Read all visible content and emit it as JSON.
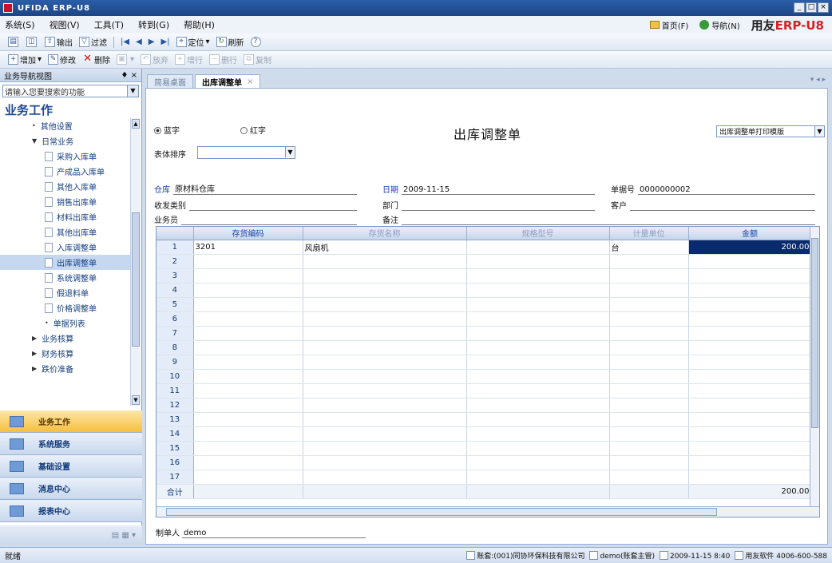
{
  "window": {
    "title": "UFIDA ERP-U8"
  },
  "menu": [
    "系统(S)",
    "视图(V)",
    "工具(T)",
    "转到(G)",
    "帮助(H)"
  ],
  "brand": {
    "home": "首页(F)",
    "nav": "导航(N)",
    "logo_a": "用友",
    "logo_b": "ERP-U8"
  },
  "toolbar1": [
    {
      "icon": "print-icon",
      "label": ""
    },
    {
      "icon": "preview-icon",
      "label": ""
    },
    {
      "icon": "export-icon",
      "label": "输出"
    },
    {
      "icon": "filter-icon",
      "label": "过滤"
    },
    {
      "icon": "first-icon",
      "label": "|◀"
    },
    {
      "icon": "prev-icon",
      "label": "◀"
    },
    {
      "icon": "next-icon",
      "label": "▶"
    },
    {
      "icon": "last-icon",
      "label": "▶|"
    },
    {
      "icon": "locate-icon",
      "label": "定位"
    },
    {
      "icon": "refresh-icon",
      "label": "刷新"
    },
    {
      "icon": "help-icon",
      "label": ""
    }
  ],
  "toolbar2": [
    {
      "icon": "add-icon",
      "label": "增加",
      "disabled": false
    },
    {
      "icon": "edit-icon",
      "label": "修改",
      "disabled": false
    },
    {
      "icon": "delete-icon",
      "label": "删除",
      "disabled": false
    },
    {
      "icon": "save-icon",
      "label": "",
      "disabled": true
    },
    {
      "icon": "discard-icon",
      "label": "放弃",
      "disabled": true
    },
    {
      "icon": "insert-row-icon",
      "label": "增行",
      "disabled": true
    },
    {
      "icon": "delete-row-icon",
      "label": "删行",
      "disabled": true
    },
    {
      "icon": "copy-icon",
      "label": "复制",
      "disabled": true
    }
  ],
  "sidebar": {
    "header": "业务导航视图",
    "pin": "♦ ×",
    "search_placeholder": "请输入您要搜索的功能",
    "section_title": "业务工作",
    "tree": [
      {
        "level": 1,
        "type": "leaf",
        "label": "其他设置"
      },
      {
        "level": 1,
        "type": "open",
        "label": "日常业务"
      },
      {
        "level": 2,
        "type": "doc",
        "label": "采购入库单"
      },
      {
        "level": 2,
        "type": "doc",
        "label": "产成品入库单"
      },
      {
        "level": 2,
        "type": "doc",
        "label": "其他入库单"
      },
      {
        "level": 2,
        "type": "doc",
        "label": "销售出库单"
      },
      {
        "level": 2,
        "type": "doc",
        "label": "材料出库单"
      },
      {
        "level": 2,
        "type": "doc",
        "label": "其他出库单"
      },
      {
        "level": 2,
        "type": "doc",
        "label": "入库调整单"
      },
      {
        "level": 2,
        "type": "doc",
        "label": "出库调整单",
        "selected": true
      },
      {
        "level": 2,
        "type": "doc",
        "label": "系统调整单"
      },
      {
        "level": 2,
        "type": "doc",
        "label": "假退料单"
      },
      {
        "level": 2,
        "type": "doc",
        "label": "价格调整单"
      },
      {
        "level": 2,
        "type": "leaf",
        "label": "单据列表"
      },
      {
        "level": 1,
        "type": "closed",
        "label": "业务核算"
      },
      {
        "level": 1,
        "type": "closed",
        "label": "财务核算"
      },
      {
        "level": 1,
        "type": "closed",
        "label": "跌价准备"
      }
    ],
    "nav_buttons": [
      {
        "label": "业务工作",
        "active": true
      },
      {
        "label": "系统服务",
        "active": false
      },
      {
        "label": "基础设置",
        "active": false
      },
      {
        "label": "消息中心",
        "active": false
      },
      {
        "label": "报表中心",
        "active": false
      }
    ]
  },
  "tabs": [
    {
      "label": "简易桌面",
      "active": false
    },
    {
      "label": "出库调整单",
      "active": true
    }
  ],
  "tabnav": "▾ ◂ ▸",
  "form": {
    "title": "出库调整单",
    "radio_blue": "蓝字",
    "radio_red": "红字",
    "template": "出库调整单打印模版",
    "sort_label": "表体排序",
    "fields": {
      "warehouse": {
        "label": "仓库",
        "value": "原材料仓库"
      },
      "date": {
        "label": "日期",
        "value": "2009-11-15"
      },
      "doc_no": {
        "label": "单据号",
        "value": "0000000002"
      },
      "category": {
        "label": "收发类别",
        "value": ""
      },
      "department": {
        "label": "部门",
        "value": ""
      },
      "customer": {
        "label": "客户",
        "value": ""
      },
      "salesman": {
        "label": "业务员",
        "value": ""
      },
      "remark": {
        "label": "备注",
        "value": ""
      }
    },
    "maker_label": "制单人",
    "maker_value": "demo"
  },
  "grid": {
    "columns": [
      "存货编码",
      "存货名称",
      "规格型号",
      "计量单位",
      "金额"
    ],
    "rows": [
      {
        "n": "1",
        "code": "3201",
        "name": "风扇机",
        "spec": "",
        "unit": "台",
        "amount": "200.00"
      },
      {
        "n": "2"
      },
      {
        "n": "3"
      },
      {
        "n": "4"
      },
      {
        "n": "5"
      },
      {
        "n": "6"
      },
      {
        "n": "7"
      },
      {
        "n": "8"
      },
      {
        "n": "9"
      },
      {
        "n": "10"
      },
      {
        "n": "11"
      },
      {
        "n": "12"
      },
      {
        "n": "13"
      },
      {
        "n": "14"
      },
      {
        "n": "15"
      },
      {
        "n": "16"
      },
      {
        "n": "17"
      }
    ],
    "total_label": "合计",
    "total_amount": "200.00"
  },
  "statusbar": {
    "left": "就绪",
    "account": "账套:(001)同协环保科技有限公司",
    "user": "demo(账套主管)",
    "datetime": "2009-11-15 8:40",
    "vendor": "用友软件 4006-600-588"
  }
}
